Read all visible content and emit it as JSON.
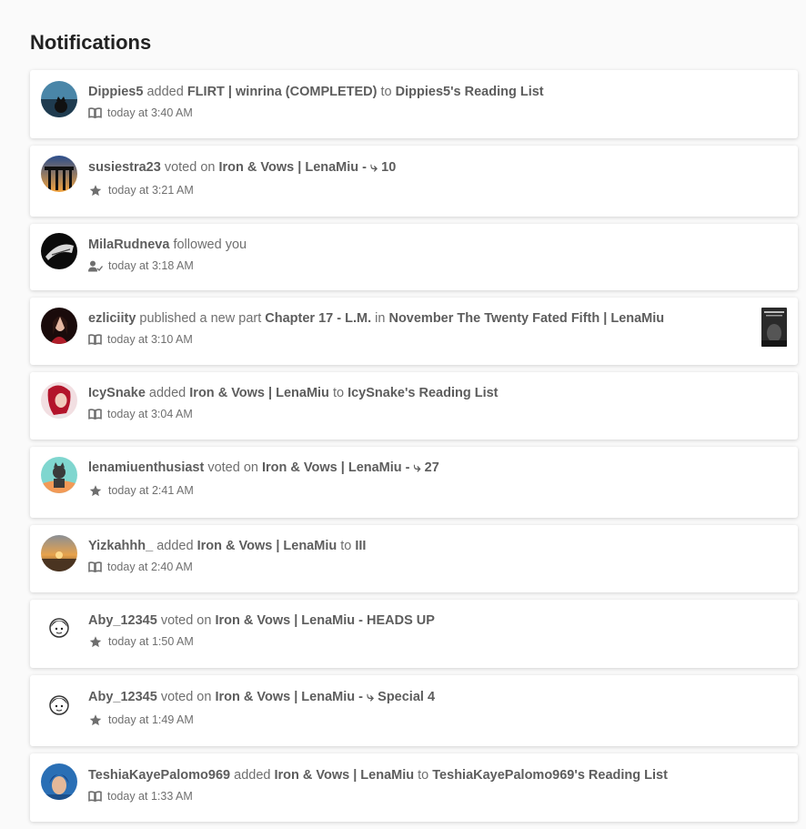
{
  "page_title": "Notifications",
  "notifications": [
    {
      "user": "Dippies5",
      "verb": "added",
      "target": "FLIRT | winrina (COMPLETED)",
      "connector": "to",
      "dest": "Dippies5's Reading List",
      "icon": "book-icon",
      "time": "today at 3:40 AM"
    },
    {
      "user": "susiestra23",
      "verb": "voted on",
      "target": "Iron & Vows | LenaMiu - ⤷ 10",
      "icon": "star-icon",
      "time": "today at 3:21 AM"
    },
    {
      "user": "MilaRudneva",
      "verb": "followed you",
      "icon": "user-check-icon",
      "time": "today at 3:18 AM"
    },
    {
      "user": "ezliciity",
      "verb": "published a new part",
      "target": "Chapter 17 - L.M.",
      "connector": "in",
      "dest": "November The Twenty Fated Fifth | LenaMiu",
      "icon": "book-icon",
      "time": "today at 3:10 AM",
      "has_thumbnail": true
    },
    {
      "user": "IcySnake",
      "verb": "added",
      "target": "Iron & Vows | LenaMiu",
      "connector": "to",
      "dest": "IcySnake's Reading List",
      "icon": "book-icon",
      "time": "today at 3:04 AM"
    },
    {
      "user": "lenamiuenthusiast",
      "verb": "voted on",
      "target": "Iron & Vows | LenaMiu - ⤷ 27",
      "icon": "star-icon",
      "time": "today at 2:41 AM"
    },
    {
      "user": "Yizkahhh_",
      "verb": "added",
      "target": "Iron & Vows | LenaMiu",
      "connector": "to",
      "dest": "III",
      "icon": "book-icon",
      "time": "today at 2:40 AM"
    },
    {
      "user": "Aby_12345",
      "verb": "voted on",
      "target": "Iron & Vows | LenaMiu - HEADS UP",
      "icon": "star-icon",
      "time": "today at 1:50 AM"
    },
    {
      "user": "Aby_12345",
      "verb": "voted on",
      "target": "Iron & Vows | LenaMiu - ⤷ Special 4",
      "icon": "star-icon",
      "time": "today at 1:49 AM"
    },
    {
      "user": "TeshiaKayePalomo969",
      "verb": "added",
      "target": "Iron & Vows | LenaMiu",
      "connector": "to",
      "dest": "TeshiaKayePalomo969's Reading List",
      "icon": "book-icon",
      "time": "today at 1:33 AM"
    }
  ],
  "colors": {
    "background": "#fafafa",
    "card": "#ffffff",
    "text": "#6f6f6f",
    "bold_text": "#5d5d5d",
    "title": "#222222"
  }
}
